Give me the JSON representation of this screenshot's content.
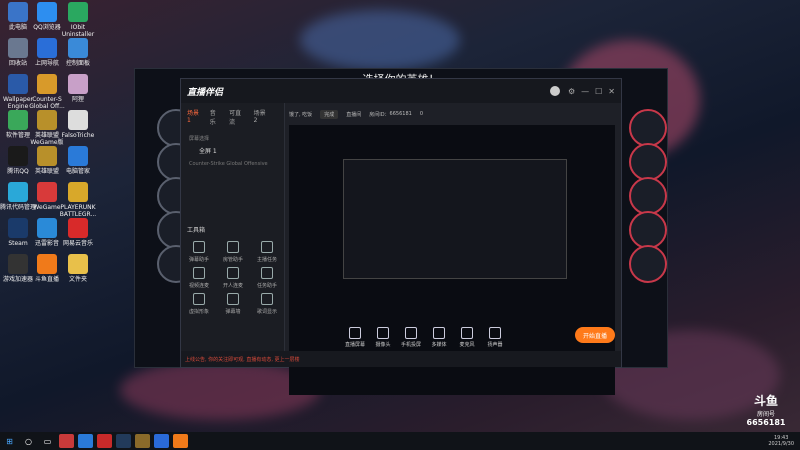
{
  "desktop_icons": [
    {
      "label": "此电脑",
      "icon": "computer-icon",
      "color": "#3a74c8"
    },
    {
      "label": "QQ浏览器",
      "icon": "qq-browser-icon",
      "color": "#2d8ef0"
    },
    {
      "label": "IObit Uninstaller",
      "icon": "iobit-icon",
      "color": "#2aa860"
    },
    {
      "label": "回收站",
      "icon": "recycle-bin-icon",
      "color": "#6a7890"
    },
    {
      "label": "上网导航",
      "icon": "ie-icon",
      "color": "#2a6ed8"
    },
    {
      "label": "控制面板",
      "icon": "control-panel-icon",
      "color": "#3a8ad8"
    },
    {
      "label": "Wallpaper Engine",
      "icon": "wallpaper-engine-icon",
      "color": "#2a5aa8"
    },
    {
      "label": "Counter-S Global Off...",
      "icon": "csgo-icon",
      "color": "#d89a2a"
    },
    {
      "label": "阿狸",
      "icon": "ali-icon",
      "color": "#c8a0c8"
    },
    {
      "label": "软件管理",
      "icon": "software-manager-icon",
      "color": "#3aa85a"
    },
    {
      "label": "英雄联盟 WeGame版",
      "icon": "lol-icon",
      "color": "#b8902a"
    },
    {
      "label": "FalsoTriche",
      "icon": "falsotriche-icon",
      "color": "#ddd"
    },
    {
      "label": "腾讯QQ",
      "icon": "qq-icon",
      "color": "#1a1a1a"
    },
    {
      "label": "英雄联盟",
      "icon": "lol-icon-2",
      "color": "#b8902a"
    },
    {
      "label": "电脑管家",
      "icon": "pc-manager-icon",
      "color": "#2a7ad8"
    },
    {
      "label": "腾讯代码管理",
      "icon": "tencent-icon",
      "color": "#2aa8d8"
    },
    {
      "label": "WeGame",
      "icon": "wegame-icon",
      "color": "#d83a3a"
    },
    {
      "label": "PLAYERUNK BATTLEGR...",
      "icon": "pubg-icon",
      "color": "#d8a82a"
    },
    {
      "label": "Steam",
      "icon": "steam-icon",
      "color": "#1a3a6a"
    },
    {
      "label": "迅雷影音",
      "icon": "xunlei-icon",
      "color": "#2a8ad8"
    },
    {
      "label": "网易云音乐",
      "icon": "netease-music-icon",
      "color": "#d82a2a"
    },
    {
      "label": "游戏加速器",
      "icon": "accelerator-icon",
      "color": "#333"
    },
    {
      "label": "斗鱼直播",
      "icon": "douyu-icon",
      "color": "#f07a1a"
    },
    {
      "label": "文件夹",
      "icon": "folder-icon",
      "color": "#e8c04a"
    }
  ],
  "game_window": {
    "title": "选择你的英雄！"
  },
  "app": {
    "logo": "直播伴侣",
    "tabs": [
      "场景1",
      "音乐",
      "可直流",
      "场景 2"
    ],
    "source_label": "全屏 1",
    "source_item": "Counter-Strike Global Offensive",
    "source_sub": "屏幕选择",
    "toolbox_label": "工具箱",
    "tools": [
      "弹幕助手",
      "房管助手",
      "主播任务",
      "视频连麦",
      "开人连麦",
      "任务助手",
      "虚拟形象",
      "弹幕墙",
      "歌词显示"
    ],
    "header": {
      "nick": "饿了, 吃饭",
      "tag": "完成",
      "room_label": "直播间",
      "id_label": "房间ID：",
      "id_value": "6656181",
      "count": "0"
    },
    "bottom_buttons": [
      "直播屏幕",
      "摄像头",
      "手机投屏",
      "多媒体",
      "麦克风",
      "扬声器"
    ],
    "live_button": "开始直播",
    "status": "上线公告, 你的关注即可观, 直播有动态, 更上一层楼"
  },
  "watermark": {
    "brand": "斗鱼",
    "sub": "房间号",
    "room": "6656181"
  },
  "taskbar": {
    "time": "19:43",
    "date": "2021/9/30"
  }
}
